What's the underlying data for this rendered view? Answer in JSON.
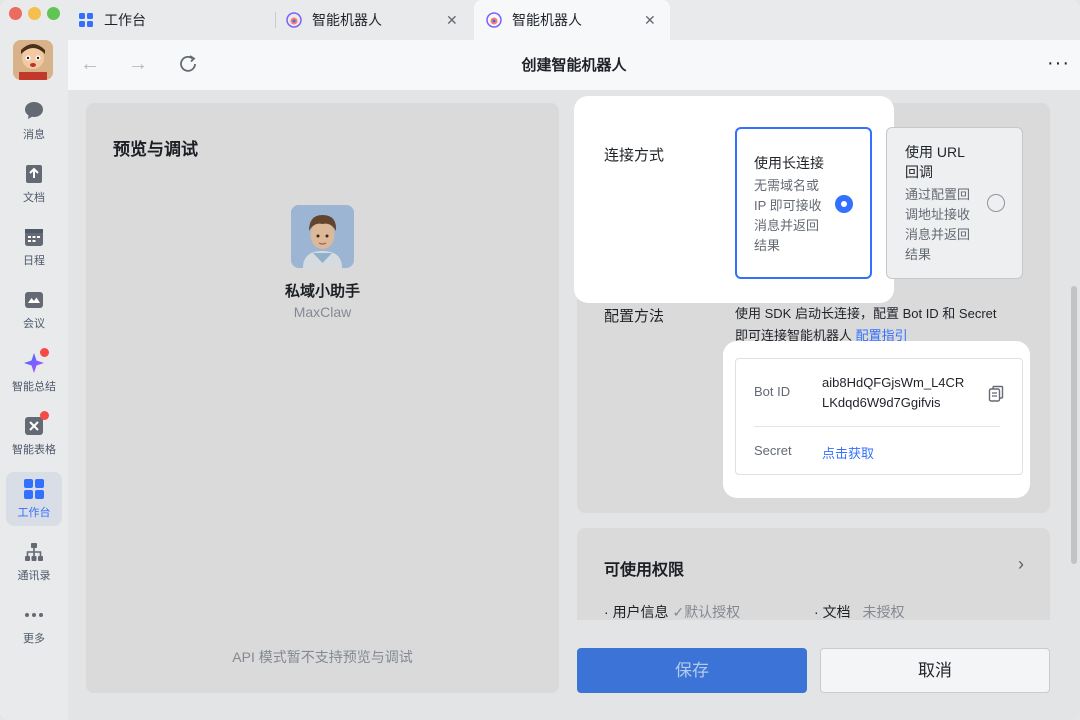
{
  "tabs": [
    {
      "label": "工作台",
      "icon": "grid-icon"
    },
    {
      "label": "智能机器人",
      "icon": "bot-icon"
    },
    {
      "label": "智能机器人",
      "icon": "bot-icon"
    }
  ],
  "sidebar": {
    "items": [
      {
        "label": "消息",
        "icon": "chat-bubble-icon"
      },
      {
        "label": "文档",
        "icon": "doc-icon"
      },
      {
        "label": "日程",
        "icon": "calendar-icon"
      },
      {
        "label": "会议",
        "icon": "video-icon"
      },
      {
        "label": "智能总结",
        "icon": "sparkle-icon",
        "badge": true
      },
      {
        "label": "智能表格",
        "icon": "table-icon",
        "badge": true
      },
      {
        "label": "工作台",
        "icon": "grid-icon",
        "active": true
      },
      {
        "label": "通讯录",
        "icon": "org-chart-icon"
      },
      {
        "label": "更多",
        "icon": "more-dots-icon"
      }
    ]
  },
  "header": {
    "title": "创建智能机器人",
    "more": "···"
  },
  "preview": {
    "title": "预览与调试",
    "bot_name": "私域小助手",
    "bot_sub": "MaxClaw",
    "note": "API 模式暂不支持预览与调试"
  },
  "connection": {
    "label": "连接方式",
    "option1": {
      "title": "使用长连接",
      "desc": [
        "无需域名或",
        "IP 即可接收",
        "消息并返回",
        "结果"
      ],
      "selected": true
    },
    "option2": {
      "title_lines": [
        "使用 URL",
        "回调"
      ],
      "desc": [
        "通过配置回",
        "调地址接收",
        "消息并返回",
        "结果"
      ],
      "selected": false
    }
  },
  "config": {
    "label": "配置方法",
    "text_line1": "使用 SDK 启动长连接，配置 Bot ID 和 Secret",
    "text_line2": "即可连接智能机器人 ",
    "link": "配置指引",
    "bot_id_label": "Bot ID",
    "bot_id_value_line1": "aib8HdQFGjsWm_L4CR",
    "bot_id_value_line2": "LKdqd6W9d7Ggifvis",
    "secret_label": "Secret",
    "secret_link": "点击获取"
  },
  "permissions": {
    "title": "可使用权限",
    "items": [
      {
        "name": "用户信息",
        "status": "默认授权",
        "checked": true
      },
      {
        "name": "文档",
        "status": "未授权",
        "checked": false
      }
    ]
  },
  "footer": {
    "save": "保存",
    "cancel": "取消"
  },
  "colors": {
    "accent": "#3370ff",
    "save_button": "#3b74d6"
  }
}
